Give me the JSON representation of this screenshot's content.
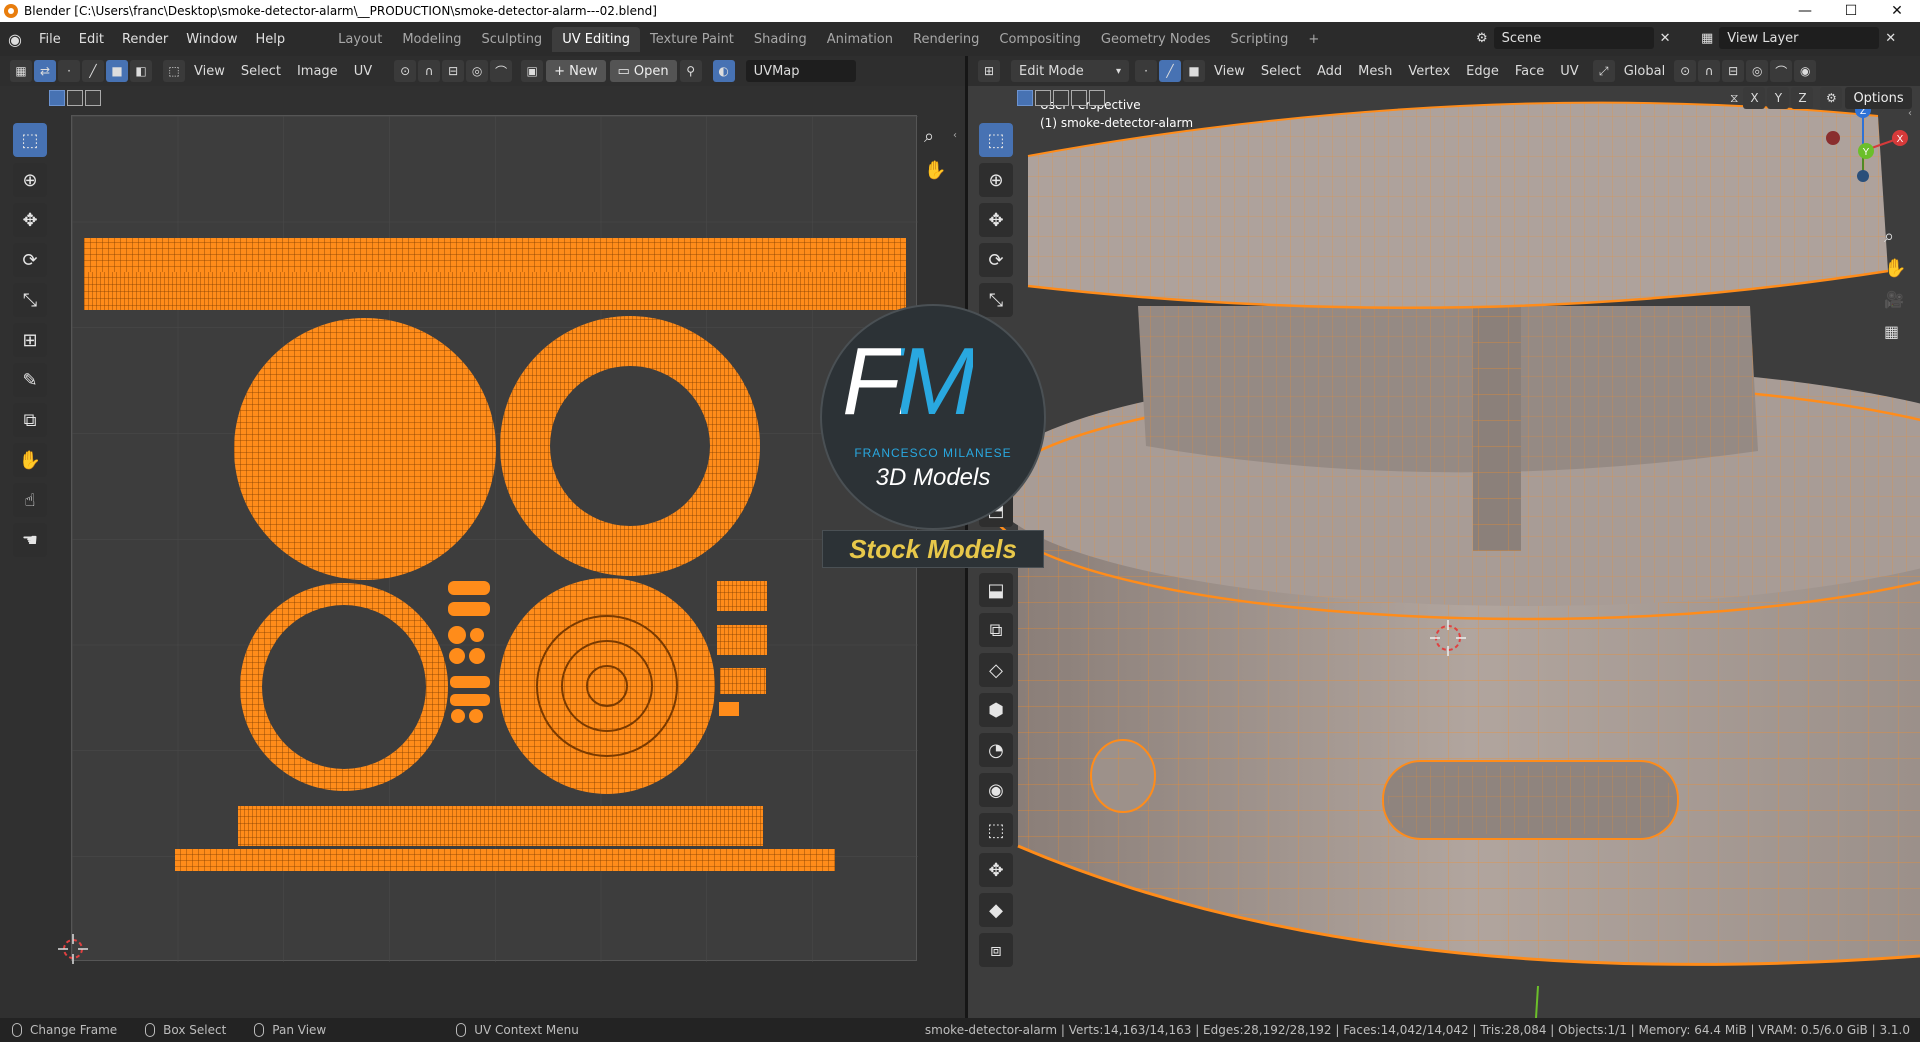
{
  "window": {
    "title": "Blender [C:\\Users\\franc\\Desktop\\smoke-detector-alarm\\__PRODUCTION\\smoke-detector-alarm---02.blend]",
    "controls": [
      "—",
      "☐",
      "✕"
    ]
  },
  "menu": {
    "items": [
      "File",
      "Edit",
      "Render",
      "Window",
      "Help"
    ],
    "workspaces": [
      "Layout",
      "Modeling",
      "Sculpting",
      "UV Editing",
      "Texture Paint",
      "Shading",
      "Animation",
      "Rendering",
      "Compositing",
      "Geometry Nodes",
      "Scripting"
    ],
    "active_workspace": "UV Editing",
    "add_tab": "+",
    "scene": "Scene",
    "view_layer": "View Layer"
  },
  "uv_editor": {
    "header": {
      "menus": [
        "View",
        "Select",
        "Image",
        "UV"
      ],
      "new_label": "New",
      "open_label": "Open",
      "uvmap": "UVMap"
    }
  },
  "viewport": {
    "header": {
      "mode": "Edit Mode",
      "menus": [
        "View",
        "Select",
        "Add",
        "Mesh",
        "Vertex",
        "Edge",
        "Face",
        "UV"
      ],
      "orientation": "Global",
      "options_label": "Options",
      "axes": [
        "X",
        "Y",
        "Z"
      ]
    },
    "overlay_title": "User Perspective",
    "overlay_object": "(1) smoke-detector-alarm",
    "gizmo": {
      "x": "X",
      "y": "Y",
      "z": "Z"
    }
  },
  "watermark": {
    "logo": "FM",
    "company": "FRANCESCO MILANESE",
    "sub": "3D Models",
    "banner": "Stock Models"
  },
  "status": {
    "left": [
      {
        "label": "Change Frame"
      },
      {
        "label": "Box Select"
      },
      {
        "label": "Pan View"
      },
      {
        "label": "UV Context Menu"
      }
    ],
    "right": "smoke-detector-alarm | Verts:14,163/14,163 | Edges:28,192/28,192 | Faces:14,042/14,042 | Tris:28,084 | Objects:1/1 | Memory: 64.4 MiB | VRAM: 0.5/6.0 GiB | 3.1.0"
  },
  "colors": {
    "accent": "#4772b3",
    "mesh_orange": "#ff8c1a",
    "background": "#1d1d1d",
    "uv_grid": "#3d3d3d",
    "watermark_text_blue": "#29a8e0",
    "watermark_banner_text": "#e8c84a"
  }
}
